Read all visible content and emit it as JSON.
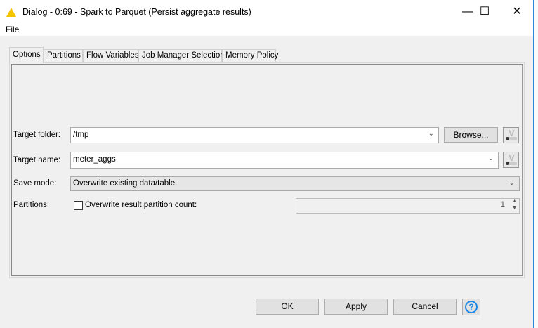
{
  "window": {
    "title": "Dialog - 0:69 - Spark to Parquet (Persist aggregate results)",
    "minimize": "—",
    "maximize": "☐",
    "close": "✕"
  },
  "menu": {
    "file": "File"
  },
  "tabs": [
    "Options",
    "Partitions",
    "Flow Variables",
    "Job Manager Selection",
    "Memory Policy"
  ],
  "form": {
    "target_folder_label": "Target folder:",
    "target_folder_value": "/tmp",
    "browse": "Browse...",
    "target_name_label": "Target name:",
    "target_name_value": "meter_aggs",
    "save_mode_label": "Save mode:",
    "save_mode_value": "Overwrite existing data/table.",
    "partitions_label": "Partitions:",
    "overwrite_label": "Overwrite result partition count:",
    "overwrite_checked": false,
    "partition_count": "1",
    "var_icon_letter": "V"
  },
  "buttons": {
    "ok": "OK",
    "apply": "Apply",
    "cancel": "Cancel",
    "help": "?"
  }
}
